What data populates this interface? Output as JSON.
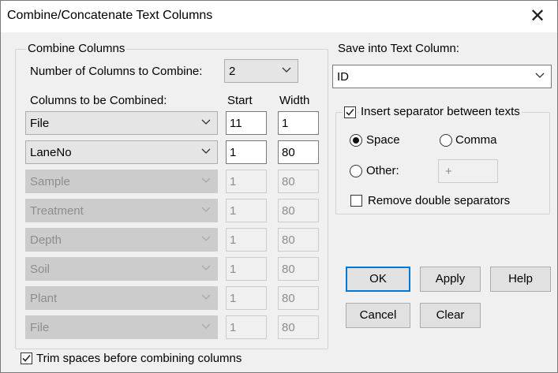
{
  "window": {
    "title": "Combine/Concatenate Text Columns"
  },
  "combine": {
    "group_title": "Combine Columns",
    "num_label": "Number of Columns to Combine:",
    "num_value": "2",
    "cols_label": "Columns to be Combined:",
    "start_label": "Start",
    "width_label": "Width",
    "rows": [
      {
        "column": "File",
        "start": "11",
        "width": "1",
        "enabled": true
      },
      {
        "column": "LaneNo",
        "start": "1",
        "width": "80",
        "enabled": true
      },
      {
        "column": "Sample",
        "start": "1",
        "width": "80",
        "enabled": false
      },
      {
        "column": "Treatment",
        "start": "1",
        "width": "80",
        "enabled": false
      },
      {
        "column": "Depth",
        "start": "1",
        "width": "80",
        "enabled": false
      },
      {
        "column": "Soil",
        "start": "1",
        "width": "80",
        "enabled": false
      },
      {
        "column": "Plant",
        "start": "1",
        "width": "80",
        "enabled": false
      },
      {
        "column": "File",
        "start": "1",
        "width": "80",
        "enabled": false
      }
    ]
  },
  "trim": {
    "label": "Trim spaces before combining columns",
    "checked": true
  },
  "save": {
    "label": "Save into Text Column:",
    "value": "ID"
  },
  "separator": {
    "insert_label": "Insert separator between texts",
    "insert_checked": true,
    "space_label": "Space",
    "comma_label": "Comma",
    "other_label": "Other:",
    "other_value": "+",
    "selected": "space",
    "remove_double_label": "Remove double separators",
    "remove_double_checked": false
  },
  "buttons": {
    "ok": "OK",
    "apply": "Apply",
    "help": "Help",
    "cancel": "Cancel",
    "clear": "Clear"
  }
}
